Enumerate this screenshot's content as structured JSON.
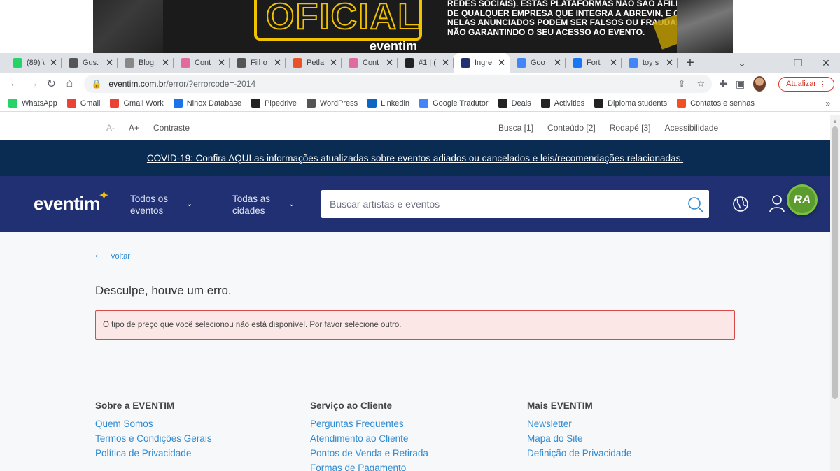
{
  "banner": {
    "stamp": "OFICIAL",
    "brand": "eventim",
    "disclaimer_lines": [
      "REDES SOCIAIS). ESTAS PLATAFORMAS NÃO SÃO AFILIADAS DA EVENTIM OU",
      "DE QUALQUER EMPRESA QUE INTEGRA A ABREVIN, E OS INGRESSOS",
      "NELAS ANUNCIADOS PODEM SER FALSOS OU FRAUDADOS,",
      "NÃO  GARANTINDO O SEU ACESSO AO EVENTO."
    ]
  },
  "tabs": [
    {
      "title": "(89) \\",
      "icon": "whatsapp-icon",
      "color": "#25d366"
    },
    {
      "title": "Gus.",
      "icon": "hat-icon",
      "color": "#555555"
    },
    {
      "title": "Blog",
      "icon": "blog-icon",
      "color": "#888888"
    },
    {
      "title": "Cont",
      "icon": "contact-icon",
      "color": "#e06c9f"
    },
    {
      "title": "Filho",
      "icon": "hat-icon",
      "color": "#555555"
    },
    {
      "title": "Petla",
      "icon": "petlove-icon",
      "color": "#e8542a"
    },
    {
      "title": "Cont",
      "icon": "contact-icon",
      "color": "#e06c9f"
    },
    {
      "title": "#1 | (",
      "icon": "podcast-icon",
      "color": "#222222"
    },
    {
      "title": "Ingre",
      "icon": "eventim-icon",
      "color": "#213072",
      "active": true
    },
    {
      "title": "Goo",
      "icon": "google-translate-icon",
      "color": "#4285f4"
    },
    {
      "title": "Fort",
      "icon": "facebook-icon",
      "color": "#1877f2"
    },
    {
      "title": "toy s",
      "icon": "google-icon",
      "color": "#4285f4"
    }
  ],
  "toolbar": {
    "host": "eventim.com.br",
    "path": "/error/?errorcode=-2014",
    "update_label": "Atualizar"
  },
  "bookmarks": [
    {
      "label": "WhatsApp",
      "icon": "whatsapp-icon",
      "color": "#25d366"
    },
    {
      "label": "Gmail",
      "icon": "gmail-icon",
      "color": "#ea4335"
    },
    {
      "label": "Gmail Work",
      "icon": "gmail-icon",
      "color": "#ea4335"
    },
    {
      "label": "Ninox Database",
      "icon": "ninox-icon",
      "color": "#1a73e8"
    },
    {
      "label": "Pipedrive",
      "icon": "pipedrive-icon",
      "color": "#222222"
    },
    {
      "label": "WordPress",
      "icon": "wordpress-icon",
      "color": "#555555"
    },
    {
      "label": "Linkedin",
      "icon": "linkedin-icon",
      "color": "#0a66c2"
    },
    {
      "label": "Google Tradutor",
      "icon": "google-translate-icon",
      "color": "#4285f4"
    },
    {
      "label": "Deals",
      "icon": "pipedrive-icon",
      "color": "#222222"
    },
    {
      "label": "Activities",
      "icon": "pipedrive-icon",
      "color": "#222222"
    },
    {
      "label": "Diploma students",
      "icon": "pipedrive-icon",
      "color": "#222222"
    },
    {
      "label": "Contatos e senhas",
      "icon": "microsoft-icon",
      "color": "#f25022"
    }
  ],
  "accessibility": {
    "font_decrease": "A-",
    "font_increase": "A+",
    "contrast": "Contraste",
    "links": [
      "Busca [1]",
      "Conteúdo [2]",
      "Rodapé [3]",
      "Acessibilidade"
    ]
  },
  "covid_banner": "COVID-19: Confira AQUI as informações atualizadas sobre eventos adiados ou cancelados e leis/recomendações relacionadas.",
  "header": {
    "logo": "eventim",
    "events_dropdown": [
      "Todos os",
      "eventos"
    ],
    "cities_dropdown": [
      "Todas as",
      "cidades"
    ],
    "search_placeholder": "Buscar artistas e eventos"
  },
  "content": {
    "back_label": "Voltar",
    "error_title": "Desculpe, houve um erro.",
    "error_message": "O tipo de preço que você selecionou não está disponível. Por favor selecione outro."
  },
  "ra_badge": "RA",
  "footer": {
    "columns": [
      {
        "title": "Sobre a EVENTIM",
        "links": [
          "Quem Somos",
          "Termos e Condições Gerais",
          "Política de Privacidade"
        ]
      },
      {
        "title": "Serviço ao Cliente",
        "links": [
          "Perguntas Frequentes",
          "Atendimento ao Cliente",
          "Pontos de Venda e Retirada",
          "Formas de Pagamento"
        ]
      },
      {
        "title": "Mais EVENTIM",
        "links": [
          "Newsletter",
          "Mapa do Site",
          "Definição de Privacidade"
        ]
      }
    ]
  },
  "colors": {
    "covid_bg": "#0b2c52",
    "header_bg": "#213072",
    "link": "#2d8bd4",
    "error_border": "#d94a4a",
    "error_bg": "#fce7e7"
  }
}
